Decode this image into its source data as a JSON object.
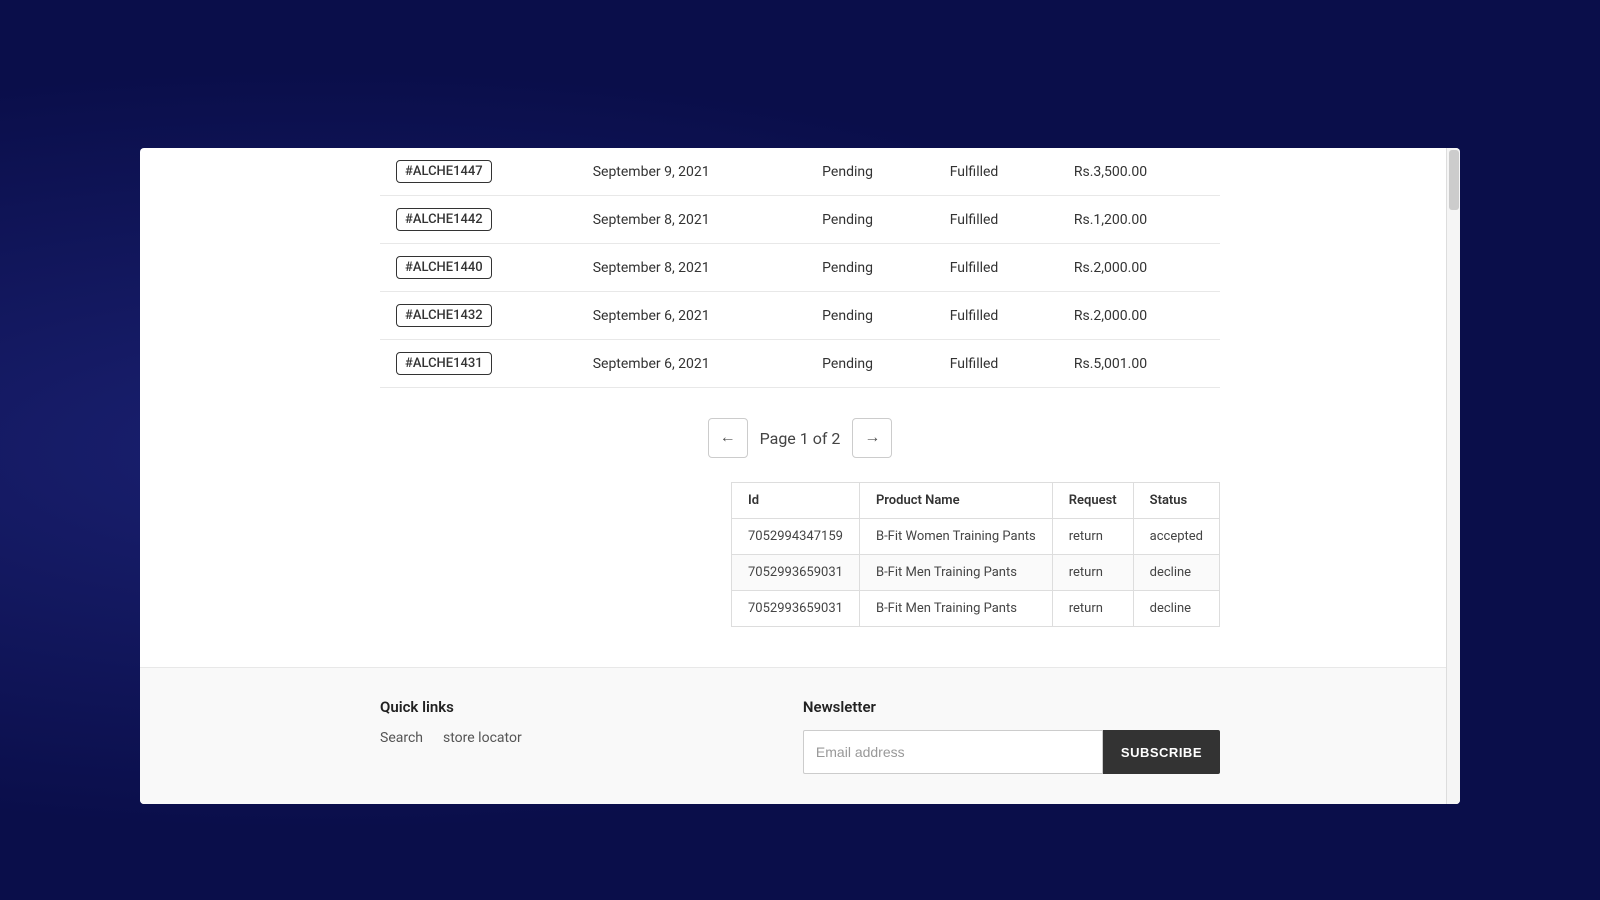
{
  "orders": {
    "rows": [
      {
        "id": "#ALCHE1447",
        "date": "September 9, 2021",
        "payment_status": "Pending",
        "fulfillment_status": "Fulfilled",
        "total": "Rs.3,500.00"
      },
      {
        "id": "#ALCHE1442",
        "date": "September 8, 2021",
        "payment_status": "Pending",
        "fulfillment_status": "Fulfilled",
        "total": "Rs.1,200.00"
      },
      {
        "id": "#ALCHE1440",
        "date": "September 8, 2021",
        "payment_status": "Pending",
        "fulfillment_status": "Fulfilled",
        "total": "Rs.2,000.00"
      },
      {
        "id": "#ALCHE1432",
        "date": "September 6, 2021",
        "payment_status": "Pending",
        "fulfillment_status": "Fulfilled",
        "total": "Rs.2,000.00"
      },
      {
        "id": "#ALCHE1431",
        "date": "September 6, 2021",
        "payment_status": "Pending",
        "fulfillment_status": "Fulfilled",
        "total": "Rs.5,001.00"
      }
    ]
  },
  "pagination": {
    "prev_label": "←",
    "next_label": "→",
    "page_text": "Page 1 of 2"
  },
  "returns": {
    "headers": [
      "Id",
      "Product Name",
      "Request",
      "Status"
    ],
    "rows": [
      {
        "id": "7052994347159",
        "product_name": "B-Fit Women Training Pants",
        "request": "return",
        "status": "accepted"
      },
      {
        "id": "7052993659031",
        "product_name": "B-Fit Men Training Pants",
        "request": "return",
        "status": "decline"
      },
      {
        "id": "7052993659031",
        "product_name": "B-Fit Men Training Pants",
        "request": "return",
        "status": "decline"
      }
    ]
  },
  "footer": {
    "quick_links": {
      "heading": "Quick links",
      "links": [
        {
          "label": "Search"
        },
        {
          "label": "store locator"
        }
      ]
    },
    "newsletter": {
      "heading": "Newsletter",
      "email_placeholder": "Email address",
      "subscribe_label": "SUBSCRIBE"
    }
  }
}
